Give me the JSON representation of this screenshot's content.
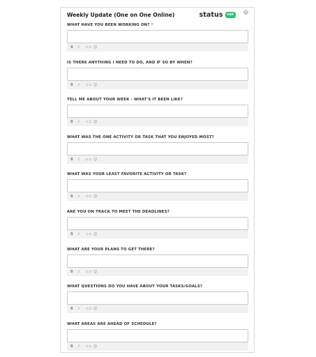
{
  "form": {
    "title": "Weekly Update (One on One Online)",
    "brand": {
      "word": "status",
      "badge": "net"
    },
    "close_glyph": "×",
    "required_marker": "*",
    "toolbar_icons": {
      "bold": "B",
      "italic": "I",
      "link": "⊂⊃",
      "emoji": "☺"
    },
    "questions": [
      {
        "label": "WHAT HAVE YOU BEEN WORKING ON?",
        "required": true
      },
      {
        "label": "IS THERE ANYTHING I NEED TO DO, AND IF SO BY WHEN?",
        "required": false
      },
      {
        "label": "TELL ME ABOUT YOUR WEEK - WHAT'S IT BEEN LIKE?",
        "required": false
      },
      {
        "label": "WHAT WAS THE ONE ACTIVITY OR TASK THAT YOU ENJOYED MOST?",
        "required": false
      },
      {
        "label": "WHAT WAS YOUR LEAST FAVORITE ACTIVITY OR TASK?",
        "required": false
      },
      {
        "label": "ARE YOU ON TRACK TO MEET THE DEADLINES?",
        "required": false
      },
      {
        "label": "WHAT ARE YOUR PLANS TO GET THERE?",
        "required": false
      },
      {
        "label": "WHAT QUESTIONS DO YOU HAVE ABOUT YOUR TASKS/GOALS?",
        "required": false
      },
      {
        "label": "WHAT AREAS ARE AHEAD OF SCHEDULE?",
        "required": false
      }
    ]
  },
  "colors": {
    "brand_badge": "#33c07a",
    "required": "#e53935",
    "toolbar_bg": "#f1f1f1"
  }
}
